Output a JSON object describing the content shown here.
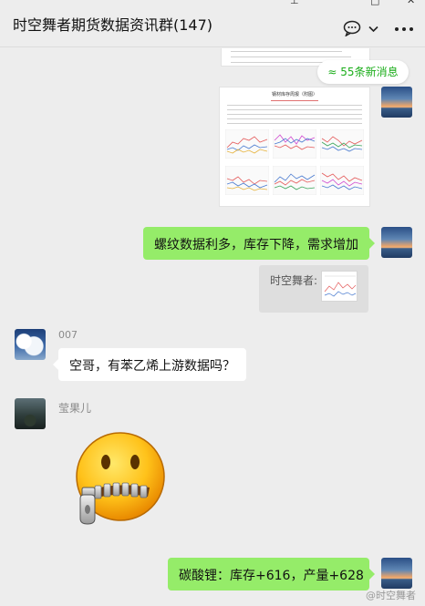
{
  "header": {
    "title": "时空舞者期货数据资讯群(147)",
    "icons": [
      "chat-bubble-icon",
      "chevron-down-icon",
      "more-icon"
    ]
  },
  "new_messages": {
    "label": "55条新消息",
    "icon": "double-chevron-up-icon"
  },
  "document_image": {
    "title": "钢材库存周报（附图）"
  },
  "messages": [
    {
      "side": "right",
      "type": "image"
    },
    {
      "side": "right",
      "type": "text",
      "text": "螺纹数据利多，库存下降，需求增加"
    },
    {
      "side": "right",
      "type": "quote",
      "text": "时空舞者:"
    },
    {
      "side": "left",
      "type": "text",
      "sender": "007",
      "text": "空哥，有苯乙烯上游数据吗？"
    },
    {
      "side": "left",
      "type": "sticker",
      "sender": "莹果儿"
    },
    {
      "side": "right",
      "type": "text",
      "text": "碳酸锂：库存+616，产量+628"
    }
  ],
  "watermark": "@时空舞者",
  "colors": {
    "background": "#ededed",
    "bubble_self": "#95ec69",
    "bubble_other": "#ffffff",
    "accent": "#1aad19"
  }
}
